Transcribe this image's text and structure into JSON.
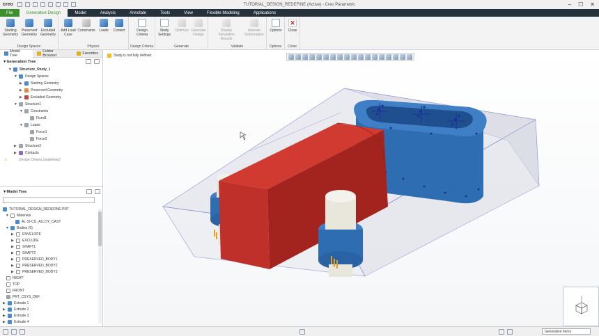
{
  "app": {
    "logo": "creo",
    "window_title": "TUTORIAL_DESIGN_REDEFINE (Active) - Creo Parametric"
  },
  "ribbon_tabs": [
    {
      "label": "File"
    },
    {
      "label": "Generative Design"
    },
    {
      "label": "Model"
    },
    {
      "label": "Analysis"
    },
    {
      "label": "Annotate"
    },
    {
      "label": "Tools"
    },
    {
      "label": "View"
    },
    {
      "label": "Flexible Modeling"
    },
    {
      "label": "Applications"
    }
  ],
  "ribbon": {
    "design_spaces": {
      "label": "Design Spaces",
      "starting": "Starting Geometry",
      "preserved": "Preserved Geometry",
      "excluded": "Excluded Geometry"
    },
    "physics": {
      "label": "Physics",
      "add_load_case": "Add Load Case",
      "constraints": "Constraints",
      "loads": "Loads",
      "contact": "Contact"
    },
    "design_criteria": {
      "label": "Design Criteria",
      "design_criteria": "Design Criteria"
    },
    "generate": {
      "label": "Generate",
      "study_settings": "Study Settings",
      "optimize": "Optimize",
      "generate_design": "Generate Design"
    },
    "validate": {
      "label": "Validate",
      "display_sim": "Display Simulation Results",
      "animate": "Animate Deformation"
    },
    "options": {
      "label": "Options",
      "options": "Options"
    },
    "close": {
      "label": "Close",
      "close": "Close"
    }
  },
  "left_panel": {
    "tabs": [
      "Model Tree",
      "Folder Browser",
      "Favorites"
    ],
    "gen_tree_title": "Generation Tree",
    "gen_tree": [
      {
        "label": "Structure_Study_1",
        "bold": true
      },
      {
        "label": "Design Spaces"
      },
      {
        "label": "Starting Geometry"
      },
      {
        "label": "Preserved Geometry"
      },
      {
        "label": "Excluded Geometry"
      },
      {
        "label": "Structure1"
      },
      {
        "label": "Constraints"
      },
      {
        "label": "Fixed1"
      },
      {
        "label": "Loads"
      },
      {
        "label": "Force1"
      },
      {
        "label": "Force2"
      },
      {
        "label": "Structure2"
      },
      {
        "label": "Contacts"
      },
      {
        "label": "Design Criteria (undefined)"
      }
    ],
    "model_tree_title": "Model Tree",
    "model_tree": [
      {
        "label": "TUTORIAL_DESIGN_REDEFINE.PRT"
      },
      {
        "label": "Materials"
      },
      {
        "label": "AL-SI-CU_ALLOY_CAST"
      },
      {
        "label": "Bodies (6)"
      },
      {
        "label": "ENVELOPE"
      },
      {
        "label": "EXCLUDE"
      },
      {
        "label": "SHAFT1"
      },
      {
        "label": "SHAFT2"
      },
      {
        "label": "PRESERVED_BODY1"
      },
      {
        "label": "PRESERVED_BODY2"
      },
      {
        "label": "PRESERVED_BODY3"
      },
      {
        "label": "RIGHT"
      },
      {
        "label": "TOP"
      },
      {
        "label": "FRONT"
      },
      {
        "label": "PRT_CSYS_DEF"
      },
      {
        "label": "Extrude 1"
      },
      {
        "label": "Extrude 2"
      },
      {
        "label": "Extrude 3"
      },
      {
        "label": "Extrude 4"
      }
    ]
  },
  "canvas": {
    "message": "Study is not fully defined"
  },
  "status_bar": {
    "filter_value": "Generative Items"
  },
  "colors": {
    "file_tab": "#3f8f2f",
    "ribbon_dark": "#25313b",
    "preserved_blue": "#2f6db3",
    "starting_red": "#c0302a"
  }
}
